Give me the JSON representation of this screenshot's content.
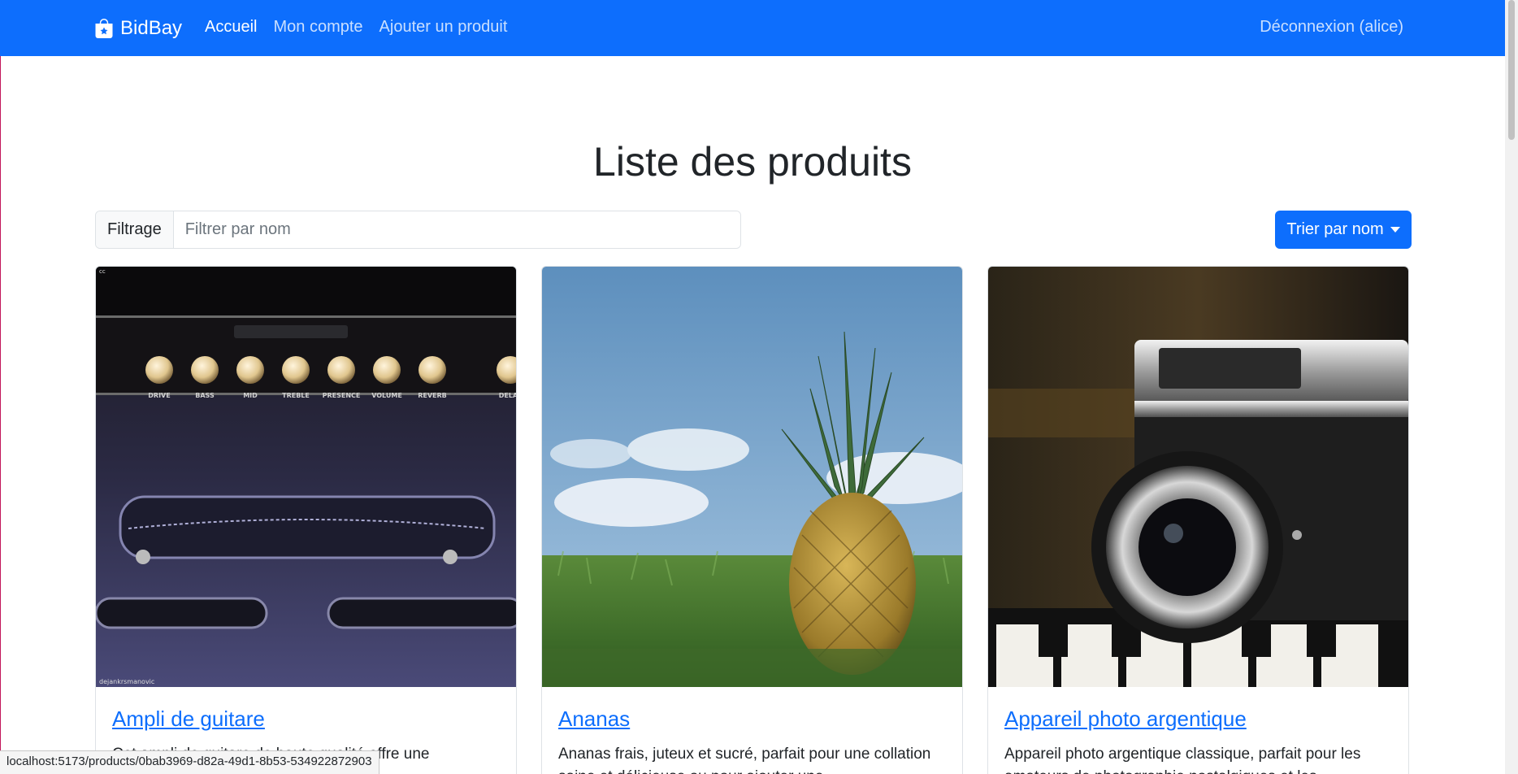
{
  "navbar": {
    "brand": "BidBay",
    "links": [
      {
        "label": "Accueil",
        "active": true
      },
      {
        "label": "Mon compte",
        "active": false
      },
      {
        "label": "Ajouter un produit",
        "active": false
      }
    ],
    "logout": "Déconnexion (alice)"
  },
  "page": {
    "title": "Liste des produits"
  },
  "filter": {
    "label": "Filtrage",
    "placeholder": "Filtrer par nom",
    "value": ""
  },
  "sort": {
    "label": "Trier par nom"
  },
  "products": [
    {
      "title": "Ampli de guitare",
      "description": "Cet ampli de guitare de haute qualité offre une",
      "image": "guitar-amplifier-photo",
      "image_caption_top": "cc",
      "image_caption_bottom": "dejankrsmanovic",
      "amp_knobs": [
        "DRIVE",
        "BASS",
        "MID",
        "TREBLE",
        "PRESENCE",
        "VOLUME",
        "REVERB",
        "DELAY"
      ]
    },
    {
      "title": "Ananas",
      "description": "Ananas frais, juteux et sucré, parfait pour une collation saine et délicieuse ou pour ajouter une",
      "image": "pineapple-in-grass-photo"
    },
    {
      "title": "Appareil photo argentique",
      "description": "Appareil photo argentique classique, parfait pour les amateurs de photographie nostalgiques et les",
      "image": "film-camera-photo"
    }
  ],
  "status_bar": {
    "url": "localhost:5173/products/0bab3969-d82a-49d1-8b53-534922872903"
  },
  "colors": {
    "primary": "#0d6efd",
    "text": "#212529",
    "border": "#dee2e6"
  }
}
